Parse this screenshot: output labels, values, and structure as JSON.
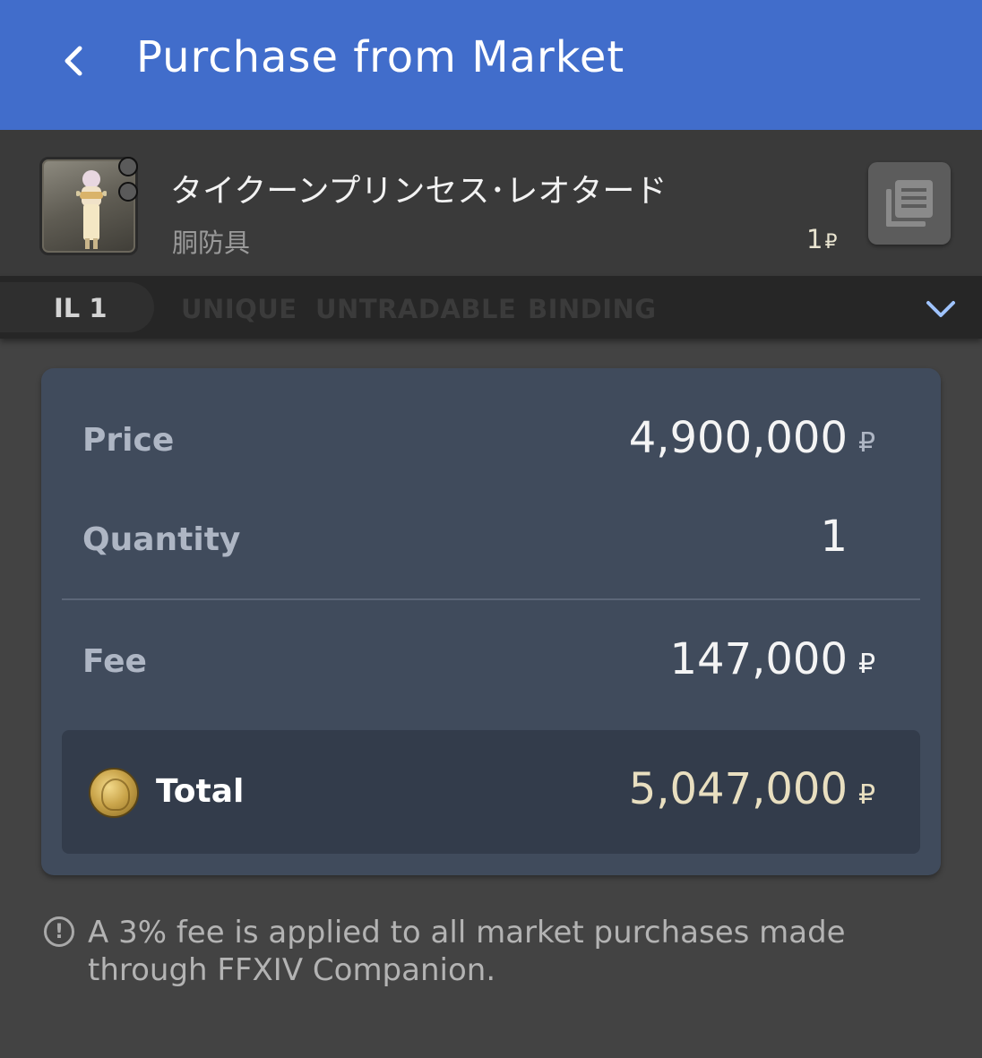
{
  "header": {
    "title": "Purchase from Market",
    "back_icon": "chevron-left-icon"
  },
  "item": {
    "name": "タイクーンプリンセス･レオタード",
    "category": "胴防具",
    "unit_price": "1",
    "currency_symbol": "₽",
    "list_icon": "list-icon"
  },
  "tags": {
    "item_level": "IL 1",
    "items": [
      "UNIQUE",
      "UNTRADABLE",
      "BINDING"
    ],
    "expand_icon": "chevron-down-icon"
  },
  "summary": {
    "price_label": "Price",
    "price_value": "4,900,000",
    "quantity_label": "Quantity",
    "quantity_value": "1",
    "fee_label": "Fee",
    "fee_value": "147,000",
    "total_label": "Total",
    "total_value": "5,047,000",
    "currency_symbol": "₽"
  },
  "note": {
    "icon": "info-icon",
    "text": "A 3% fee is applied to all market purchases made through FFXIV Companion."
  },
  "colors": {
    "header_bg": "#416dcb",
    "page_bg": "#434343",
    "card_bg": "#404b5c",
    "total_bg": "#333c4b",
    "accent_chevron": "#9fc3ff"
  }
}
